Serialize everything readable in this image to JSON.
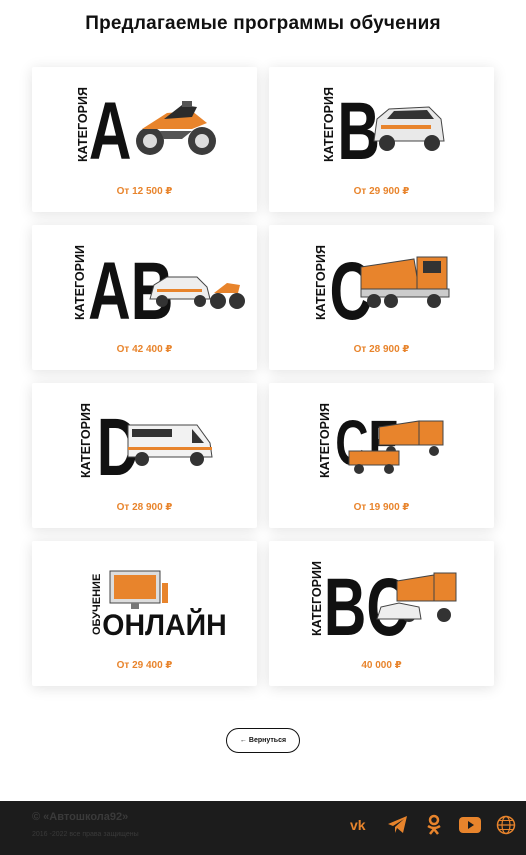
{
  "page": {
    "title": "Предлагаемые программы обучения"
  },
  "cards": [
    {
      "word": "КАТЕГОРИЯ",
      "letter": "A",
      "price": "От 12 500 ₽"
    },
    {
      "word": "КАТЕГОРИЯ",
      "letter": "B",
      "price": "От 29 900 ₽"
    },
    {
      "word": "КАТЕГОРИИ",
      "letter": "AB",
      "price": "От 42 400 ₽"
    },
    {
      "word": "КАТЕГОРИЯ",
      "letter": "C",
      "price": "От 28 900 ₽"
    },
    {
      "word": "КАТЕГОРИЯ",
      "letter": "D",
      "price": "От 28 900 ₽"
    },
    {
      "word": "КАТЕГОРИЯ",
      "letter": "CE",
      "price": "От 19 900 ₽"
    },
    {
      "word": "ОБУЧЕНИЕ",
      "letter": "ОНЛАЙН",
      "price": "От 29 400 ₽"
    },
    {
      "word": "КАТЕГОРИИ",
      "letter": "BC",
      "price": "40 000 ₽"
    }
  ],
  "back_button": {
    "arrow": "←",
    "label": "Вернуться"
  },
  "footer": {
    "copyright": "© «Автошкола92»",
    "rights": "2016 -2022 все права защищены",
    "social_icons": [
      "vk-icon",
      "telegram-icon",
      "odnoklassniki-icon",
      "youtube-icon",
      "globe-icon"
    ]
  },
  "colors": {
    "accent": "#e8842c",
    "footer_bg": "#1c1c1c",
    "text": "#111111"
  }
}
